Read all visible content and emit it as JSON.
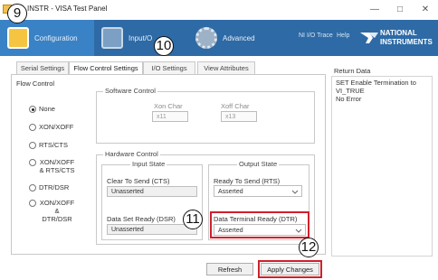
{
  "window": {
    "title": "INSTR - VISA Test Panel",
    "minimize": "—",
    "maximize": "□",
    "close": "✕"
  },
  "toolbar": {
    "configuration": "Configuration",
    "input": "Input/O",
    "advanced": "Advanced",
    "ni_io_trace": "NI I/O Trace",
    "help": "Help",
    "logo_line1": "NATIONAL",
    "logo_line2": "INSTRUMENTS"
  },
  "tabs": [
    {
      "label": "Serial Settings",
      "active": false
    },
    {
      "label": "Flow Control Settings",
      "active": true
    },
    {
      "label": "I/O Settings",
      "active": false
    },
    {
      "label": "View Attributes",
      "active": false
    }
  ],
  "flow_control": {
    "title": "Flow Control",
    "options": [
      {
        "label": "None",
        "checked": true
      },
      {
        "label": "XON/XOFF",
        "checked": false
      },
      {
        "label": "RTS/CTS",
        "checked": false
      },
      {
        "label": "XON/XOFF & RTS/CTS",
        "checked": false
      },
      {
        "label": "DTR/DSR",
        "checked": false
      },
      {
        "label": "XON/XOFF & DTR/DSR",
        "checked": false
      }
    ]
  },
  "software_control": {
    "title": "Software Control",
    "xon_label": "Xon Char",
    "xon_value": "x11",
    "xoff_label": "Xoff Char",
    "xoff_value": "x13"
  },
  "hardware_control": {
    "title": "Hardware Control",
    "input_state_title": "Input State",
    "output_state_title": "Output State",
    "cts_label": "Clear To Send (CTS)",
    "cts_value": "Unasserted",
    "rts_label": "Ready To Send (RTS)",
    "rts_value": "Asserted",
    "dsr_label": "Data Set Ready (DSR)",
    "dsr_value": "Unasserted",
    "dtr_label": "Data Terminal Ready (DTR)",
    "dtr_value": "Asserted"
  },
  "buttons": {
    "refresh": "Refresh",
    "apply": "Apply Changes"
  },
  "return_data": {
    "title": "Return Data",
    "lines": [
      "SET Enable Termination to",
      "VI_TRUE",
      "No Error"
    ]
  },
  "callouts": {
    "c9": "9",
    "c10": "10",
    "c11": "11",
    "c12": "12"
  },
  "colors": {
    "toolbar_blue": "#2e6aa5",
    "highlight_red": "#d0202a"
  }
}
